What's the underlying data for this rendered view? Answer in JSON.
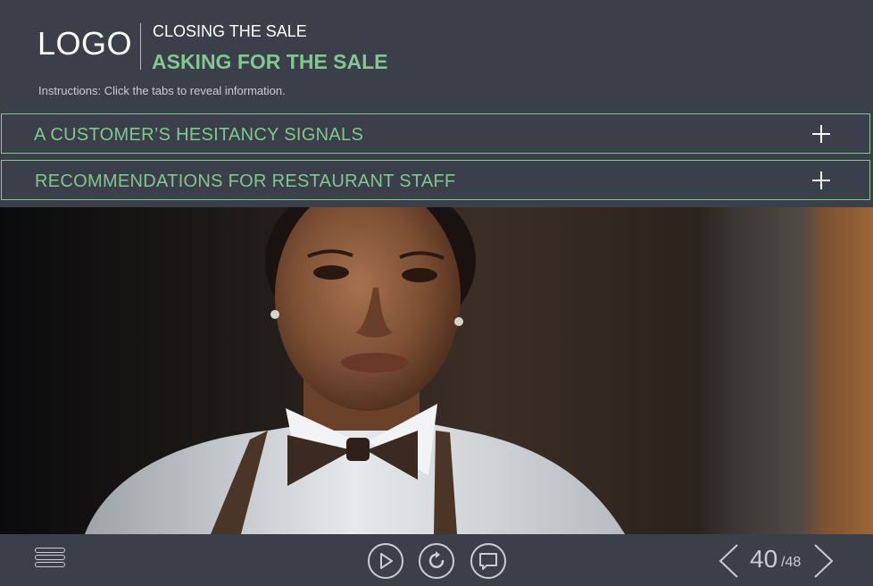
{
  "header": {
    "logo_text": "LOGO",
    "module_title": "CLOSING THE SALE",
    "slide_title": "ASKING FOR THE SALE",
    "instructions": "Instructions: Click the tabs to reveal information."
  },
  "tabs": [
    {
      "label": "A CUSTOMER’S HESITANCY SIGNALS",
      "icon": "plus-icon"
    },
    {
      "label": "RECOMMENDATIONS FOR RESTAURANT STAFF",
      "icon": "plus-icon"
    }
  ],
  "photo": {
    "subject": "server-portrait"
  },
  "player": {
    "menu_icon": "menu-icon",
    "play_icon": "play-icon",
    "replay_icon": "replay-icon",
    "comment_icon": "comment-icon",
    "page_current": "40",
    "page_total": "/48"
  },
  "colors": {
    "background": "#3a3f49",
    "accent": "#7fc98f",
    "text": "#ffffff",
    "muted": "#c8ccd3"
  }
}
